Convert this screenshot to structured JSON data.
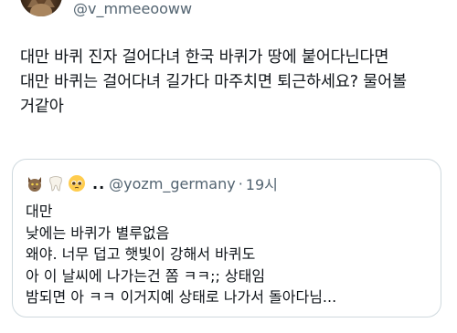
{
  "tweet": {
    "handle": "@v_mmeeooww",
    "text_lines": [
      "대만 바퀴 진자 걸어다녀 한국 바퀴가 땅에 붙어다닌다면",
      "대만 바퀴는 걸어다녀 길가다 마주치면 퇴근하세요? 물어볼",
      "거같아"
    ]
  },
  "quote": {
    "icons": [
      "cat-icon",
      "tooth-icon",
      "pleading-face-icon"
    ],
    "name": "..",
    "handle": "@yozm_germany",
    "separator": "·",
    "time": "19시",
    "text_lines": [
      "대만",
      "낮에는 바퀴가 별루없음",
      "왜야. 너무 덥고 햇빛이 강해서 바퀴도",
      "아 이 날씨에 나가는건 쫌 ㅋㅋ;; 상태임",
      "밤되면 아 ㅋㅋ 이거지예 상태로 나가서 돌아다님..."
    ]
  }
}
